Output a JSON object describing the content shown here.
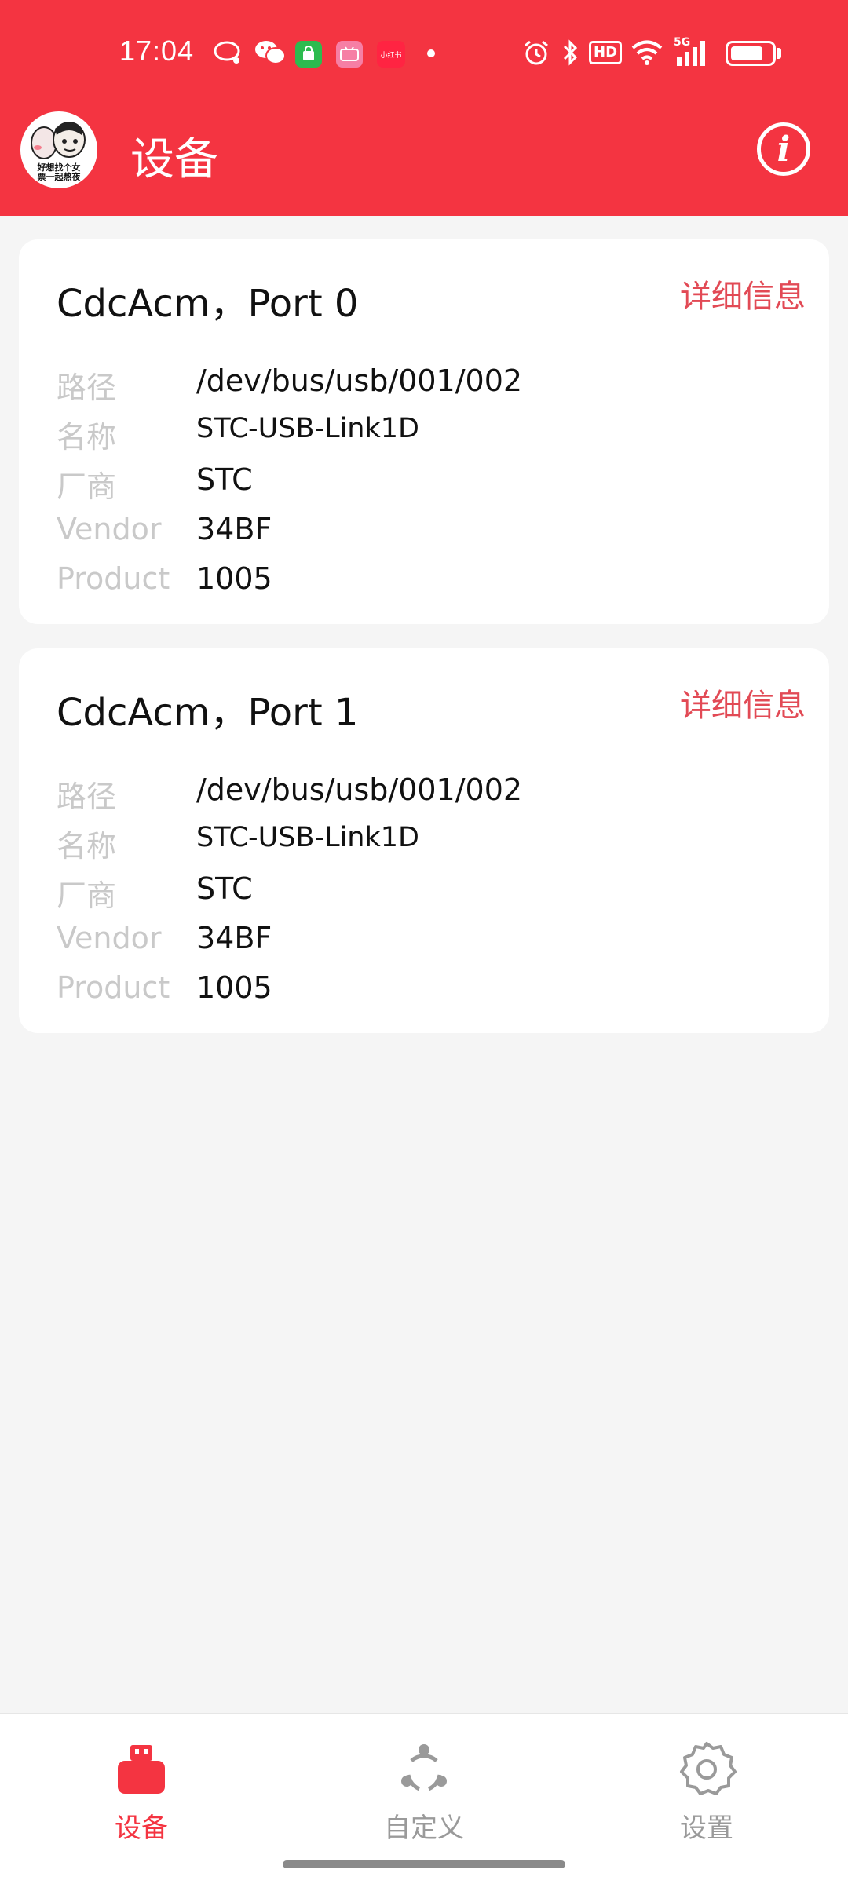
{
  "status_bar": {
    "time": "17:04",
    "notification_icons": [
      "chat-bubble-icon",
      "wechat-icon",
      "shopping-bag-icon",
      "bilibili-icon",
      "xiaohongshu-icon"
    ],
    "xiaohongshu_label": "小红书",
    "system_icons": [
      "alarm-icon",
      "bluetooth-icon",
      "hd-icon",
      "wifi-icon",
      "signal-icon",
      "battery-icon"
    ],
    "hd_label": "HD",
    "network_label": "5G",
    "battery_level": 0.8
  },
  "header": {
    "title": "设备",
    "avatar_caption_line1": "好想找个女",
    "avatar_caption_line2": "票一起熬夜",
    "info_icon": "i",
    "background_color": "#f43441"
  },
  "devices": [
    {
      "title": "CdcAcm，Port 0",
      "detail_label": "详细信息",
      "fields": [
        {
          "label": "路径",
          "value": "/dev/bus/usb/001/002"
        },
        {
          "label": "名称",
          "value": "STC-USB-Link1D"
        },
        {
          "label": "厂商",
          "value": "STC"
        },
        {
          "label": "Vendor",
          "value": "34BF"
        },
        {
          "label": "Product",
          "value": "1005"
        }
      ]
    },
    {
      "title": "CdcAcm，Port 1",
      "detail_label": "详细信息",
      "fields": [
        {
          "label": "路径",
          "value": "/dev/bus/usb/001/002"
        },
        {
          "label": "名称",
          "value": "STC-USB-Link1D"
        },
        {
          "label": "厂商",
          "value": "STC"
        },
        {
          "label": "Vendor",
          "value": "34BF"
        },
        {
          "label": "Product",
          "value": "1005"
        }
      ]
    }
  ],
  "bottom_nav": {
    "items": [
      {
        "label": "设备",
        "icon": "usb-device-icon",
        "active": true
      },
      {
        "label": "自定义",
        "icon": "share-nodes-icon",
        "active": false
      },
      {
        "label": "设置",
        "icon": "gear-icon",
        "active": false
      }
    ],
    "active_color": "#f43441",
    "inactive_color": "#9a9a9a"
  }
}
